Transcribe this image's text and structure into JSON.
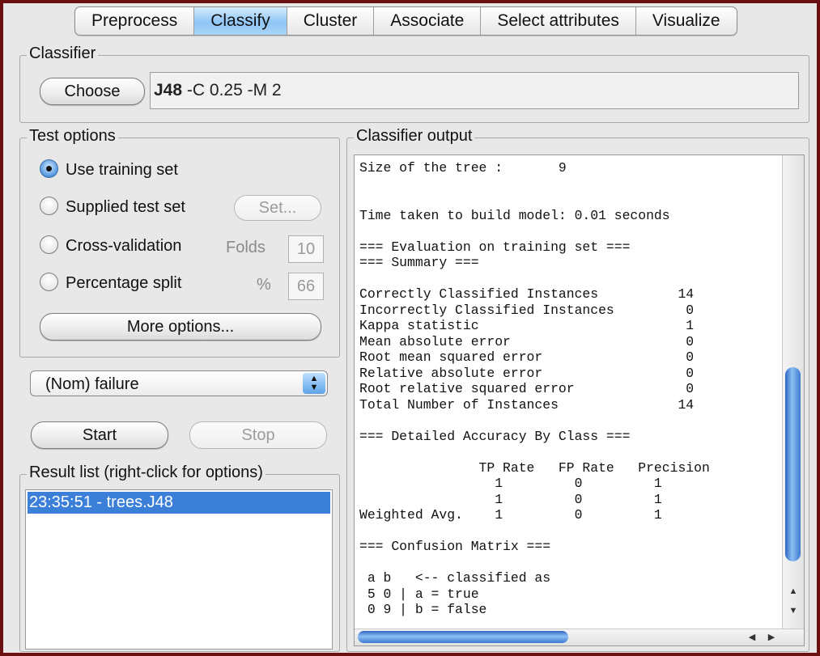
{
  "tabs": [
    "Preprocess",
    "Classify",
    "Cluster",
    "Associate",
    "Select attributes",
    "Visualize"
  ],
  "classifier": {
    "title": "Classifier",
    "choose_label": "Choose",
    "name": "J48",
    "options": "-C 0.25 -M 2"
  },
  "test_options": {
    "title": "Test options",
    "use_training_set": "Use training set",
    "supplied_test_set": "Supplied test set",
    "set_label": "Set...",
    "cross_validation": "Cross-validation",
    "folds_label": "Folds",
    "folds_value": "10",
    "percentage_split": "Percentage split",
    "percent_label": "%",
    "percent_value": "66",
    "more_options_label": "More options...",
    "selected": "use_training_set"
  },
  "class_attribute": "(Nom) failure",
  "run": {
    "start_label": "Start",
    "stop_label": "Stop"
  },
  "result_list": {
    "title": "Result list (right-click for options)",
    "items": [
      "23:35:51 - trees.J48"
    ]
  },
  "output": {
    "title": "Classifier output",
    "lines": [
      "Size of the tree :       9",
      "",
      "",
      "Time taken to build model: 0.01 seconds",
      "",
      "=== Evaluation on training set ===",
      "=== Summary ===",
      "",
      "Correctly Classified Instances          14",
      "Incorrectly Classified Instances         0",
      "Kappa statistic                          1",
      "Mean absolute error                      0",
      "Root mean squared error                  0",
      "Relative absolute error                  0",
      "Root relative squared error              0",
      "Total Number of Instances               14",
      "",
      "=== Detailed Accuracy By Class ===",
      "",
      "               TP Rate   FP Rate   Precision",
      "                 1         0         1",
      "                 1         0         1",
      "Weighted Avg.    1         0         1",
      "",
      "=== Confusion Matrix ===",
      "",
      " a b   <-- classified as",
      " 5 0 | a = true",
      " 0 9 | b = false"
    ]
  },
  "colors": {
    "frame": "#6b1010",
    "selected_tab": "#8fc6f5",
    "selection": "#3b7fd9",
    "scroll_thumb": "#3d7ad0"
  },
  "icons": {
    "select_arrows": "up-down-chevron-icon",
    "scroll_up": "triangle-up-icon",
    "scroll_down": "triangle-down-icon",
    "scroll_left": "triangle-left-icon",
    "scroll_right": "triangle-right-icon"
  }
}
